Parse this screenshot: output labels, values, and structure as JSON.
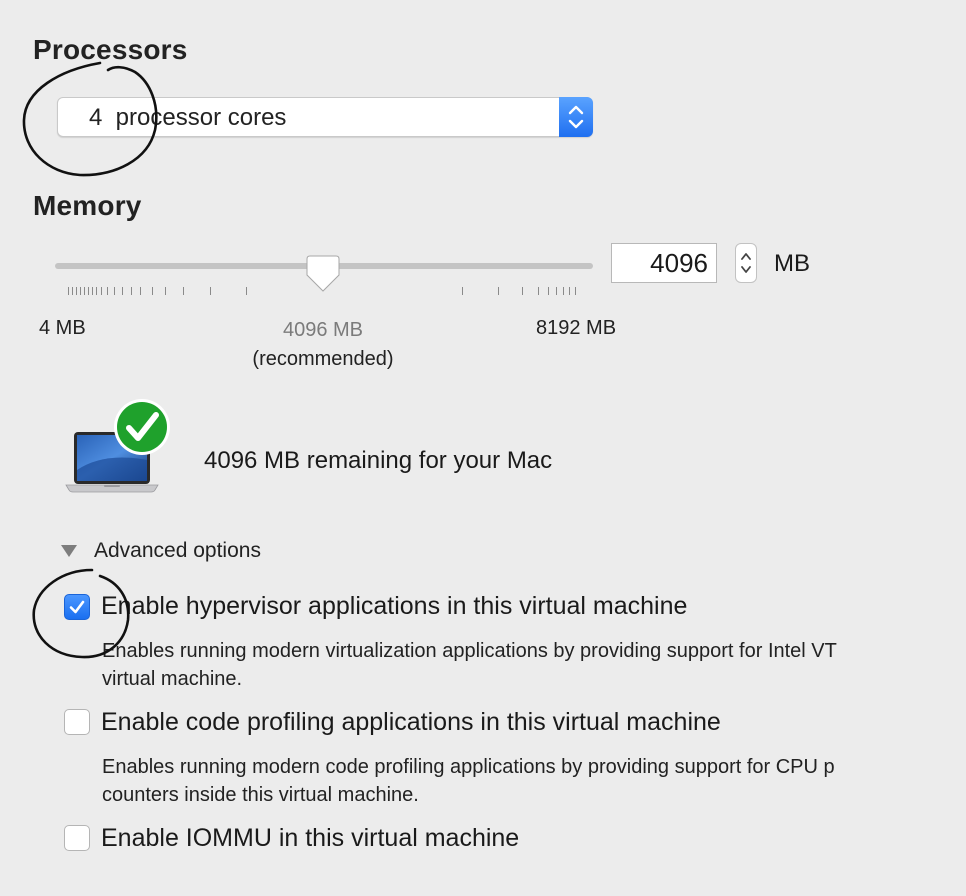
{
  "processors": {
    "title": "Processors",
    "selected": "4  processor cores"
  },
  "memory": {
    "title": "Memory",
    "value": "4096",
    "unit": "MB",
    "slider_value_mb": 4096,
    "slider_min_mb": 4,
    "slider_max_mb": 8192,
    "min_label": "4 MB",
    "recommended_value": "4096 MB",
    "recommended_note": "(recommended)",
    "max_label": "8192 MB"
  },
  "status": {
    "remaining_text": "4096 MB remaining for your Mac"
  },
  "advanced": {
    "label": "Advanced options",
    "options": [
      {
        "label": "Enable hypervisor applications in this virtual machine",
        "checked": true,
        "desc_line1": "Enables running modern virtualization applications by providing support for Intel VT",
        "desc_line2": "virtual machine."
      },
      {
        "label": "Enable code profiling applications in this virtual machine",
        "checked": false,
        "desc_line1": "Enables running modern code profiling applications by providing support for CPU p",
        "desc_line2": "counters inside this virtual machine."
      },
      {
        "label": "Enable IOMMU in this virtual machine",
        "checked": false
      }
    ]
  },
  "colors": {
    "background": "#ececec",
    "accent": "#1f6ff0",
    "check_green": "#1fa12c",
    "annotation_ink": "#111111"
  },
  "icons": {
    "popup_stepper": "up-down-chevron-icon",
    "mac": "macbook-icon",
    "ok": "green-checkmark-icon",
    "disclosure": "disclosure-triangle-down-icon"
  }
}
